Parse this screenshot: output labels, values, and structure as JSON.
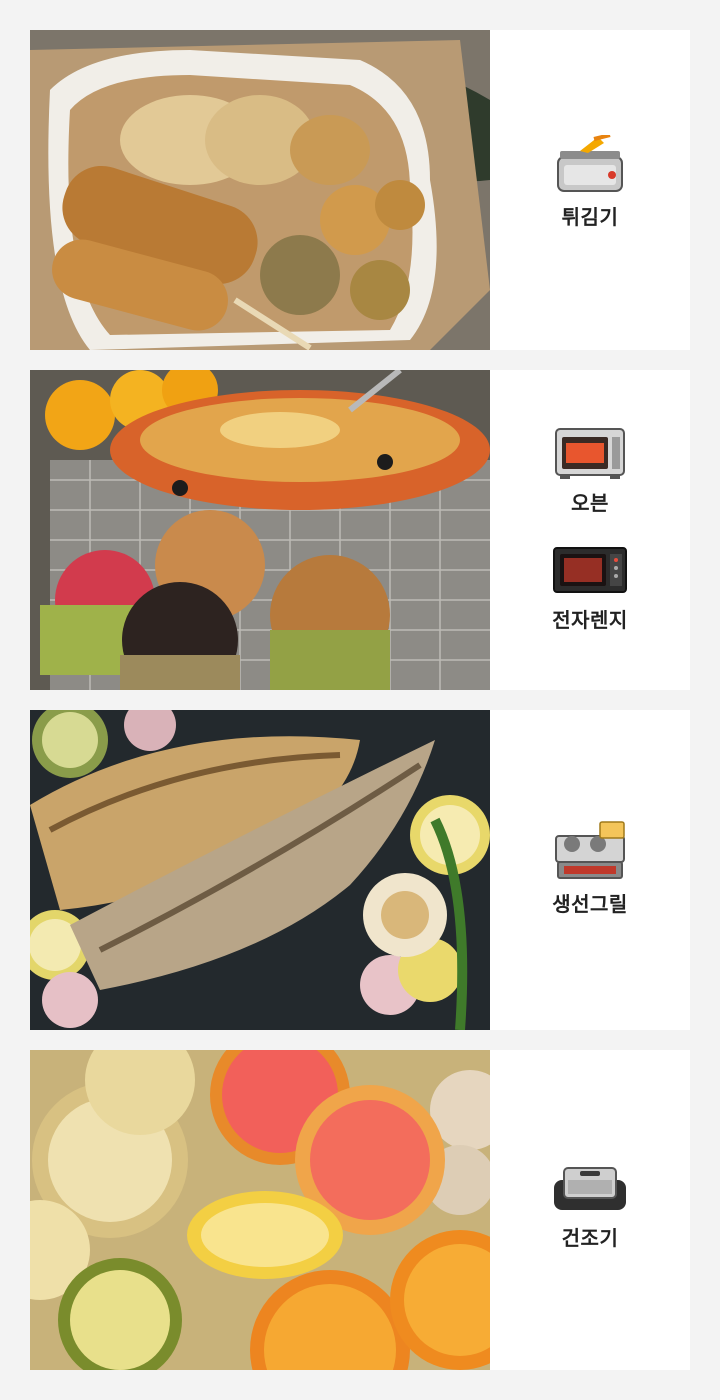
{
  "rows": [
    {
      "photo_subject": "fried dumplings, corn dog and croquettes",
      "appliances": [
        {
          "label": "튀김기",
          "icon": "deep-fryer-icon"
        }
      ]
    },
    {
      "photo_subject": "baked pasta gratin and muffins",
      "appliances": [
        {
          "label": "오븐",
          "icon": "oven-icon"
        },
        {
          "label": "전자렌지",
          "icon": "microwave-icon"
        }
      ]
    },
    {
      "photo_subject": "grilled mackerel with lemon and garlic",
      "appliances": [
        {
          "label": "생선그릴",
          "icon": "fish-grill-icon"
        }
      ]
    },
    {
      "photo_subject": "dried fruit slices: apple, grapefruit, orange, lemon",
      "appliances": [
        {
          "label": "건조기",
          "icon": "food-dryer-icon"
        }
      ]
    }
  ],
  "colors": {
    "page_background": "#f3f3f3",
    "card_background": "#ffffff",
    "label_text": "#222222"
  }
}
